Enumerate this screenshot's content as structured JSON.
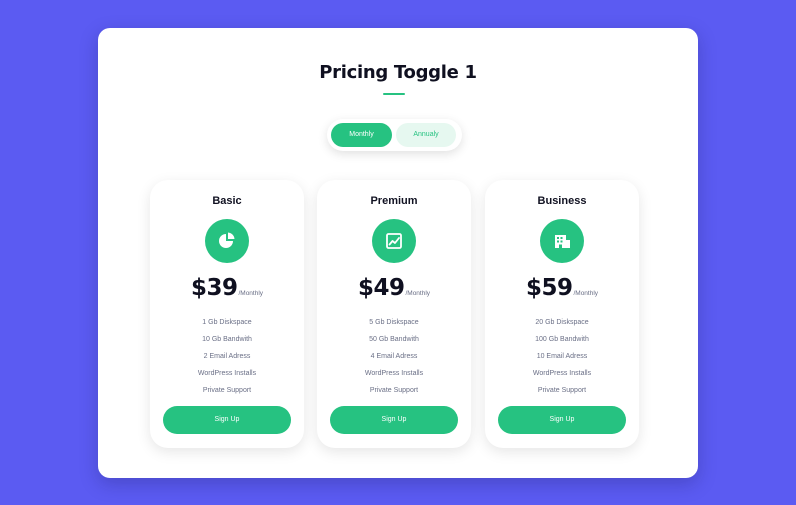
{
  "colors": {
    "background": "#5b5bf2",
    "accent": "#26c281",
    "panel": "#ffffff"
  },
  "header": {
    "title": "Pricing Toggle 1"
  },
  "toggle": {
    "monthly_label": "Monthly",
    "annualy_label": "Annualy",
    "selected": "Monthly"
  },
  "plans": [
    {
      "name": "Basic",
      "icon": "pie-chart-icon",
      "price": "$39",
      "period": "/Monthly",
      "features": [
        "1 Gb Diskspace",
        "10 Gb Bandwith",
        "2 Email Adress",
        "WordPress Installs",
        "Private Support"
      ],
      "button_label": "Sign Up"
    },
    {
      "name": "Premium",
      "icon": "line-chart-icon",
      "price": "$49",
      "period": "/Monthly",
      "features": [
        "5 Gb Diskspace",
        "50 Gb Bandwith",
        "4 Email Adress",
        "WordPress Installs",
        "Private Support"
      ],
      "button_label": "Sign Up"
    },
    {
      "name": "Business",
      "icon": "building-icon",
      "price": "$59",
      "period": "/Monthly",
      "features": [
        "20 Gb Diskspace",
        "100 Gb Bandwith",
        "10 Email Adress",
        "WordPress Installs",
        "Private Support"
      ],
      "button_label": "Sign Up"
    }
  ]
}
